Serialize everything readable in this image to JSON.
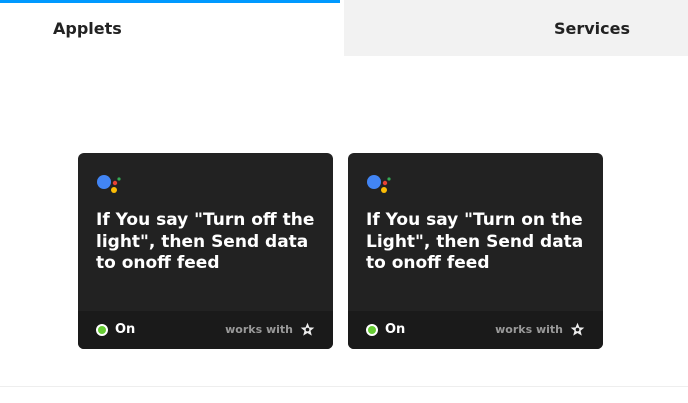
{
  "tabs": {
    "applets_label": "Applets",
    "services_label": "Services"
  },
  "applets": [
    {
      "icon": "google-assistant-icon",
      "title": "If You say \"Turn off the light\", then Send data to onoff feed",
      "status": "On",
      "works_with_label": "works with",
      "works_with_icon": "star-icon"
    },
    {
      "icon": "google-assistant-icon",
      "title": "If You say \"Turn on the Light\", then Send data to onoff feed",
      "status": "On",
      "works_with_label": "works with",
      "works_with_icon": "star-icon"
    }
  ],
  "colors": {
    "tab_indicator": "#0099ff",
    "card_background": "#222222",
    "card_footer": "#1a1a1a",
    "status_on": "#66cc33",
    "assistant_blue": "#4285f4",
    "assistant_red": "#ea4335",
    "assistant_yellow": "#fbbc05",
    "assistant_green": "#34a853"
  }
}
